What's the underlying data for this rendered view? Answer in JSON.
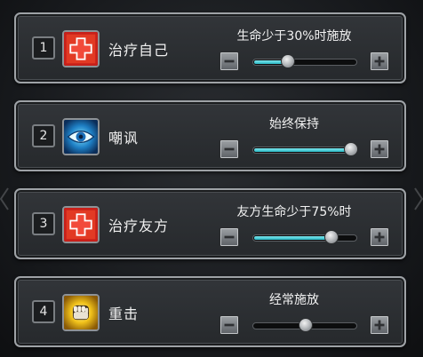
{
  "header": {
    "faded_title": "······"
  },
  "rows": [
    {
      "index": "1",
      "skill_icon": "red-cross-heal-icon",
      "skill_name": "治疗自己",
      "condition": "生命少于30%时施放",
      "slider_value_fraction": 0.3,
      "fill": true
    },
    {
      "index": "2",
      "skill_icon": "blue-eye-taunt-icon",
      "skill_name": "嘲讽",
      "condition": "始终保持",
      "slider_value_fraction": 1.0,
      "fill": true
    },
    {
      "index": "3",
      "skill_icon": "red-cross-heal-icon",
      "skill_name": "治疗友方",
      "condition": "友方生命少于75%时",
      "slider_value_fraction": 0.78,
      "fill": true
    },
    {
      "index": "4",
      "skill_icon": "golden-fist-strike-icon",
      "skill_name": "重击",
      "condition": "经常施放",
      "slider_value_fraction": 0.5,
      "fill": false
    }
  ],
  "controls": {
    "decrease_icon": "minus-button-icon",
    "increase_icon": "plus-button-icon"
  },
  "colors": {
    "slider_fill": "#2bb8c4",
    "panel_border": "#9ea2a6",
    "heal_icon_red": "#d8231c",
    "taunt_icon_blue": "#38b6ea",
    "strike_icon_gold": "#f1c21b"
  }
}
